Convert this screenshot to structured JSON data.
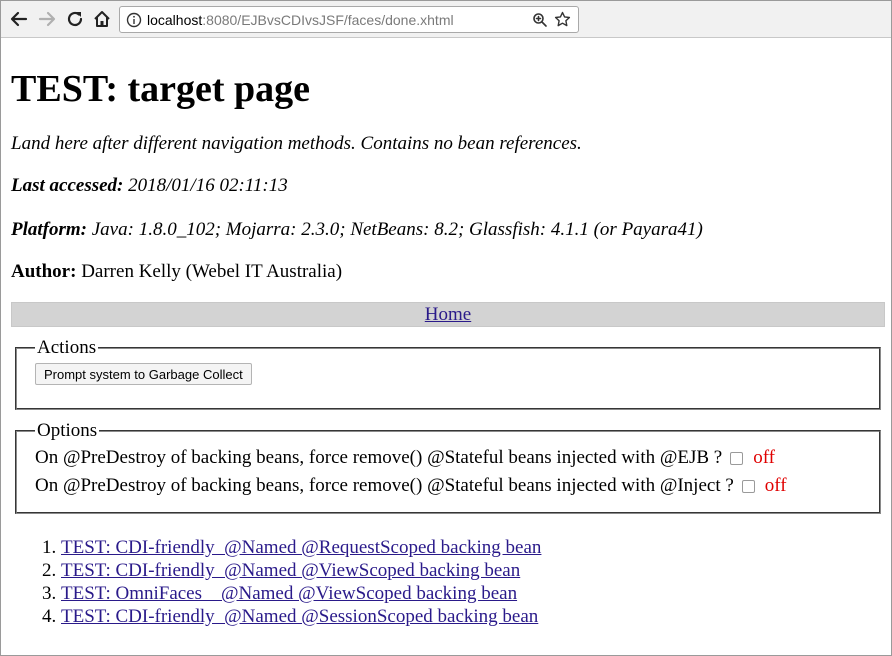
{
  "browser": {
    "url_host": "localhost",
    "url_rest": ":8080/EJBvsCDIvsJSF/faces/done.xhtml",
    "icons": [
      "back-arrow-icon",
      "forward-arrow-icon",
      "reload-icon",
      "home-icon",
      "info-icon",
      "zoom-icon",
      "star-icon"
    ]
  },
  "page": {
    "title": "TEST: target page",
    "description": "Land here after different navigation methods. Contains no bean references.",
    "last_accessed_label": "Last accessed:",
    "last_accessed_value": " 2018/01/16 02:11:13",
    "platform_label": "Platform:",
    "platform_value": " Java: 1.8.0_102;  Mojarra: 2.3.0; NetBeans: 8.2; Glassfish: 4.1.1 (or Payara41)",
    "author_label": "Author:",
    "author_value": " Darren Kelly (Webel IT Australia)",
    "home_link": "Home"
  },
  "actions": {
    "legend": "Actions",
    "gc_button": "Prompt system to Garbage Collect"
  },
  "options": {
    "legend": "Options",
    "rows": [
      {
        "label": "On @PreDestroy of backing beans, force remove() @Stateful beans injected with @EJB ?",
        "state": "off"
      },
      {
        "label": "On @PreDestroy of backing beans, force remove() @Stateful beans injected with @Inject ?",
        "state": "off"
      }
    ]
  },
  "links": [
    "TEST: CDI-friendly  @Named @RequestScoped backing bean",
    "TEST: CDI-friendly  @Named @ViewScoped backing bean",
    "TEST: OmniFaces    @Named @ViewScoped backing bean",
    "TEST: CDI-friendly  @Named @SessionScoped backing bean"
  ],
  "colors": {
    "off_state": "#e00000",
    "link": "#2a1a8a",
    "home_bar": "#d3d3d3"
  }
}
